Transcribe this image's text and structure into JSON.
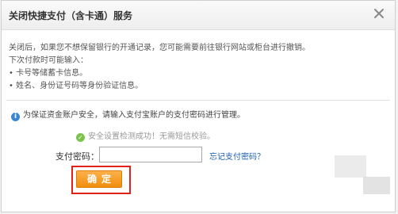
{
  "dialog": {
    "title": "关闭快捷支付（含卡通）服务",
    "close_icon": "close-icon"
  },
  "intro": {
    "line1": "关闭后，如果您不想保留银行的开通记录，您可能需要前往银行网站或柜台进行撤销。",
    "line2": "下次付款时可能输入：",
    "bullet1": "• 卡号等储蓄卡信息。",
    "bullet2": "• 姓名、身份证号码等身份验证信息。"
  },
  "notice": {
    "icon": "info-icon",
    "text": "为保证资金账户安全，请输入支付宝账户的支付密码进行管理。"
  },
  "status": {
    "icon": "check-circle-icon",
    "text": "安全设置检测成功！无需短信校验。"
  },
  "password": {
    "label": "支付密码：",
    "value": "",
    "forgot_link": "忘记支付密码？"
  },
  "confirm": {
    "label": "确定"
  },
  "colors": {
    "accent": "#f18e0f",
    "highlight": "#e3211b",
    "link": "#1b5fb4",
    "info": "#3a86d1",
    "success": "#7cc24c"
  }
}
